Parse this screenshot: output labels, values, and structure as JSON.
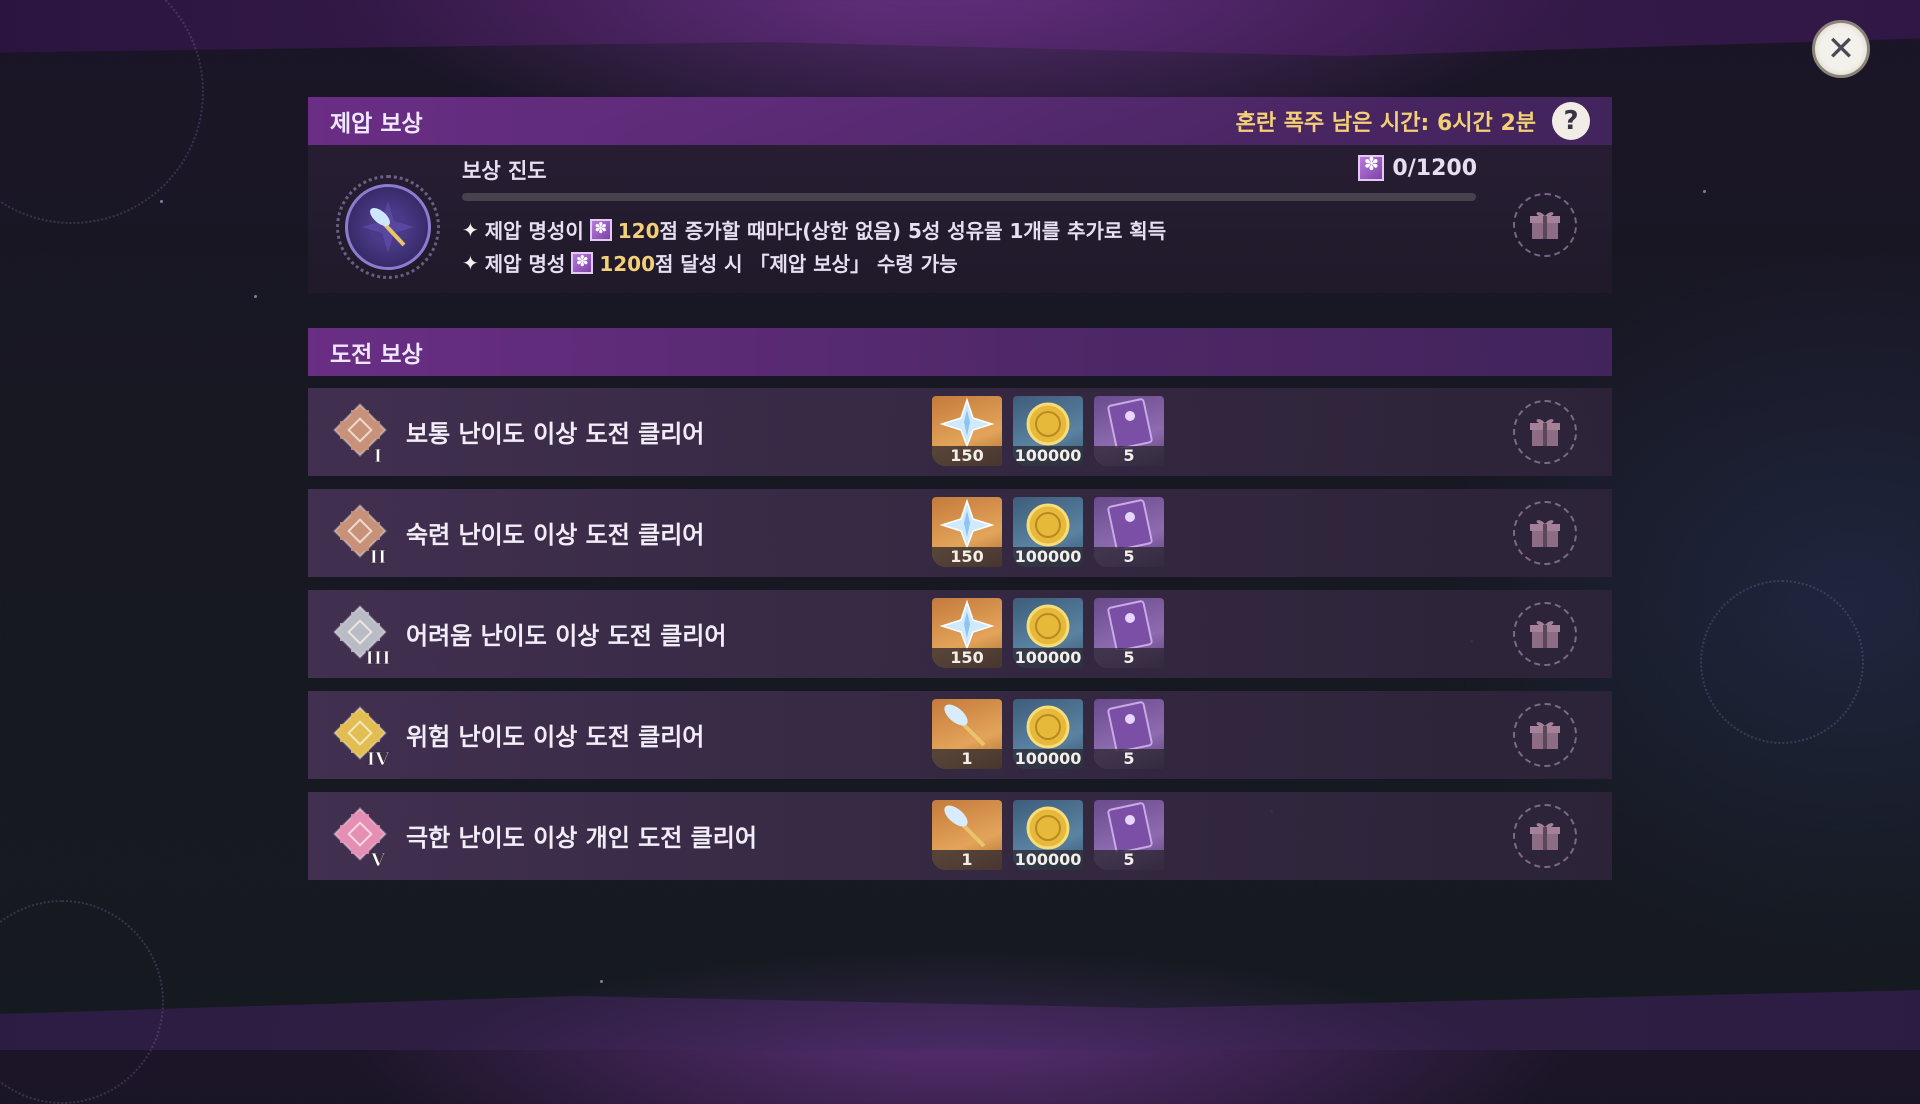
{
  "suppression": {
    "title": "제압 보상",
    "timer_text": "혼란 폭주 남은 시간: 6시간 2분",
    "help_label": "?",
    "progress_label": "보상 진도",
    "progress_count": "0/1200",
    "progress_fraction": 0,
    "rules": [
      {
        "prefix": "제압 명성이",
        "value": "120",
        "suffix": "점 증가할 때마다(상한 없음) 5성 성유물 1개를 추가로 획득"
      },
      {
        "prefix": "제압 명성",
        "value": "1200",
        "suffix": "점 달성 시 「제압 보상」 수령 가능"
      }
    ]
  },
  "challenge": {
    "title": "도전 보상",
    "rows": [
      {
        "tier": "I",
        "label": "보통 난이도 이상 도전 클리어",
        "badge_color": "#c8917a",
        "items": [
          "150",
          "100000",
          "5"
        ]
      },
      {
        "tier": "II",
        "label": "숙련 난이도 이상 도전 클리어",
        "badge_color": "#c8917a",
        "items": [
          "150",
          "100000",
          "5"
        ]
      },
      {
        "tier": "III",
        "label": "어려움 난이도 이상 도전 클리어",
        "badge_color": "#b9bcc4",
        "items": [
          "150",
          "100000",
          "5"
        ]
      },
      {
        "tier": "IV",
        "label": "위험 난이도 이상 도전 클리어",
        "badge_color": "#e2bd52",
        "items": [
          "1",
          "100000",
          "5"
        ]
      },
      {
        "tier": "V",
        "label": "극한 난이도 이상 개인 도전 클리어",
        "badge_color": "#e58fb4",
        "items": [
          "1",
          "100000",
          "5"
        ]
      }
    ]
  },
  "icons": {
    "close": "close-icon",
    "gift": "gift-icon",
    "primogem": "primogem-icon",
    "mora": "mora-coin-icon",
    "book": "experience-book-icon",
    "wand": "wand-icon",
    "reputation": "reputation-icon"
  },
  "colors": {
    "accent_gold": "#f3cf78",
    "header_purple": "#7a3296",
    "progress_fill": "#c08ee6"
  }
}
